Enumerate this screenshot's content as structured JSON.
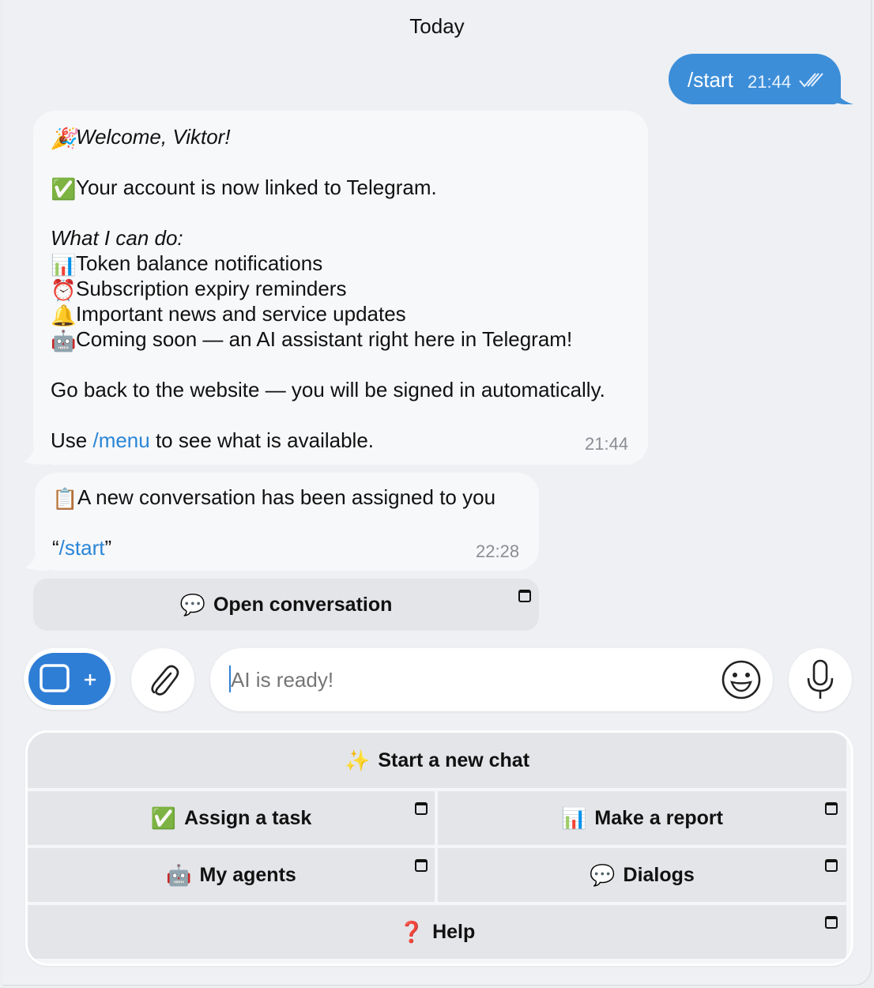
{
  "date_header": "Today",
  "outgoing": {
    "text": "/start",
    "time": "21:44"
  },
  "welcome_message": {
    "title": "Welcome, Viktor!",
    "linked": "Your account is now linked to Telegram.",
    "can_do_heading": "What I can do:",
    "features": [
      {
        "icon": "bar-chart-icon",
        "text": "Token balance notifications"
      },
      {
        "icon": "alarm-clock-icon",
        "text": "Subscription expiry reminders"
      },
      {
        "icon": "bell-icon",
        "text": "Important news and service updates"
      },
      {
        "icon": "robot-icon",
        "text": "Coming soon — an AI assistant right here in Telegram!"
      }
    ],
    "go_back": "Go back to the website — you will be signed in automatically.",
    "use_prefix": "Use ",
    "use_link": "/menu",
    "use_suffix": " to see what is available.",
    "time": "21:44"
  },
  "assigned_message": {
    "text": "A new conversation has been assigned to you",
    "quote_open": "“",
    "quote_link": "/start",
    "quote_close": "”",
    "time": "22:28"
  },
  "open_conversation_label": "Open conversation",
  "input": {
    "placeholder": "AI is ready!"
  },
  "keyboard": {
    "start_new_chat": "Start a new chat",
    "assign_task": "Assign a task",
    "make_report": "Make a report",
    "my_agents": "My agents",
    "dialogs": "Dialogs",
    "help": "Help"
  },
  "colors": {
    "accent": "#3d8ed8",
    "link": "#2a85d6",
    "bubble": "#f7f8fa",
    "button": "#e4e5e8"
  }
}
